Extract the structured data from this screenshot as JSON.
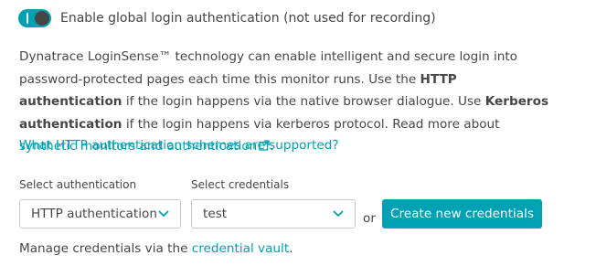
{
  "toggle": {
    "label": "Enable global login authentication (not used for recording)",
    "state": "on"
  },
  "description": {
    "part1": "Dynatrace LoginSense™ technology can enable intelligent and secure login into password-protected pages each time this monitor runs. Use the ",
    "bold1": "HTTP authentication",
    "part2": " if the login happens via the native browser dialogue. Use ",
    "bold2": "Kerberos authentication",
    "part3": " if the login happens via kerberos protocol. Read more about ",
    "link": "synthetic monitors and authentication",
    "part4": "."
  },
  "faq_link": "What HTTP authentication schemes are supported?",
  "form": {
    "auth_label": "Select authentication",
    "auth_value": "HTTP authentication",
    "cred_label": "Select credentials",
    "cred_value": "test",
    "or_text": "or",
    "create_button": "Create new credentials"
  },
  "footer": {
    "text": "Manage credentials via the ",
    "link": "credential vault",
    "suffix": "."
  },
  "colors": {
    "accent": "#00a1b2",
    "text": "#454646",
    "border": "#c9c9c9"
  },
  "icons": [
    "toggle-switch",
    "external-link-icon",
    "chevron-down-icon"
  ]
}
